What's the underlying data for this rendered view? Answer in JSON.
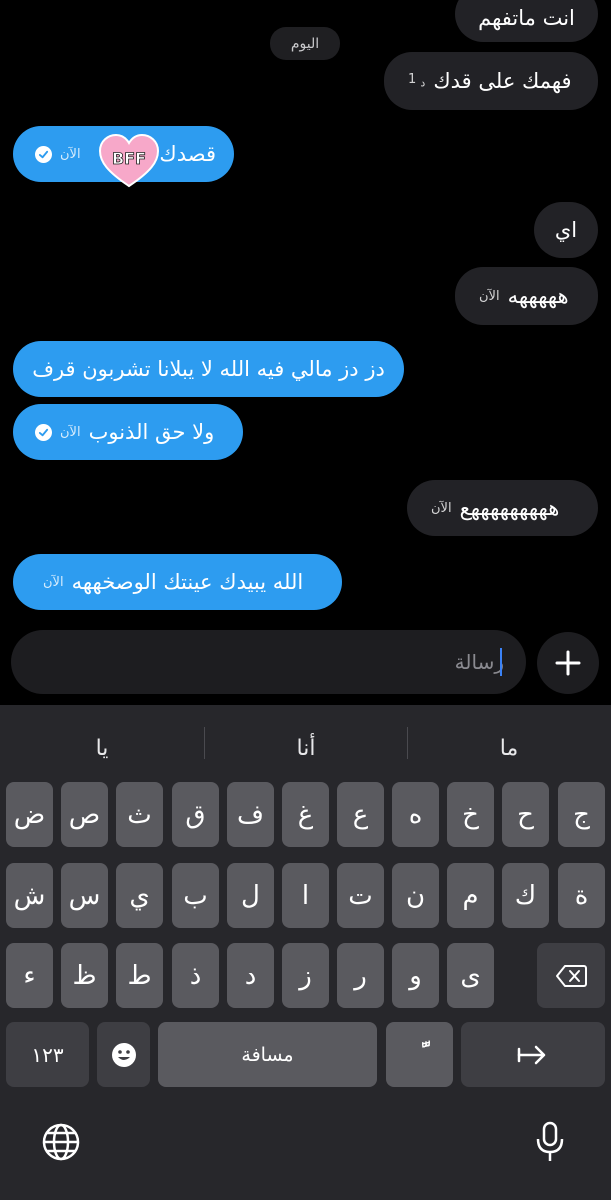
{
  "chat": {
    "date_chip": "اليوم",
    "messages": [
      {
        "text": "انت ماتفهم",
        "time": ""
      },
      {
        "text": "فهمك على قدك",
        "time": "1",
        "time_unit": "د"
      },
      {
        "text": "قصدك؟",
        "time": "الآن"
      },
      {
        "text": "اي",
        "time": ""
      },
      {
        "text": "هههههه",
        "time": "الآن"
      },
      {
        "text": "دز دز مالي فيه الله لا يبلانا تشربون قرف",
        "time": ""
      },
      {
        "text": "ولا حق الذنوب",
        "time": "الآن"
      },
      {
        "text": "هههههههههع",
        "time": "الآن"
      },
      {
        "text": "الله يبيدك عينتك الوصخههه",
        "time": "الآن"
      }
    ],
    "sticker_text": "BFF"
  },
  "composer": {
    "placeholder": "رسالة"
  },
  "keyboard": {
    "suggestions": [
      "ما",
      "أنا",
      "يا"
    ],
    "row1": [
      "ض",
      "ص",
      "ث",
      "ق",
      "ف",
      "غ",
      "ع",
      "ه",
      "خ",
      "ح",
      "ج"
    ],
    "row2": [
      "ش",
      "س",
      "ي",
      "ب",
      "ل",
      "ا",
      "ت",
      "ن",
      "م",
      "ك",
      "ة"
    ],
    "row3": [
      "ء",
      "ظ",
      "ط",
      "ذ",
      "د",
      "ز",
      "ر",
      "و",
      "ى"
    ],
    "numbers_key": "١٢٣",
    "space_key": "مسافة",
    "tanween_key": "ًّ"
  },
  "colors": {
    "outgoing": "#2d9cf0",
    "incoming": "#222226",
    "background": "#000000"
  }
}
